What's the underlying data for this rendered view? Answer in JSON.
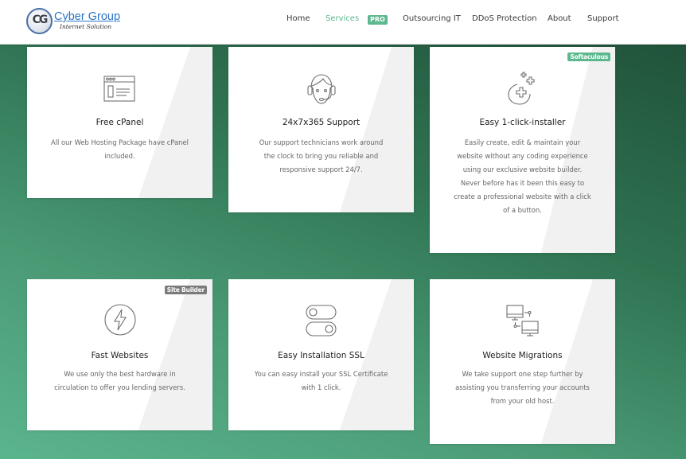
{
  "header": {
    "logo": {
      "mark": "CG",
      "title": "Cyber Group",
      "subtitle": "Internet Solution"
    },
    "nav": [
      {
        "label": "Home",
        "active": false
      },
      {
        "label": "Services",
        "active": true
      },
      {
        "label": "Outsourcing IT",
        "active": false
      },
      {
        "label": "DDoS Protection",
        "active": false
      },
      {
        "label": "About",
        "active": false
      },
      {
        "label": "Support",
        "active": false
      }
    ],
    "nav_badge": "PRO"
  },
  "colors": {
    "accent": "#5cb88f",
    "badge_gray": "#7b7b7b",
    "bg_dark": "#1e4d36",
    "bg_light": "#5bb58d"
  },
  "features": [
    {
      "icon": "browser-window-icon",
      "title": "Free cPanel",
      "lines": [
        "All our Web Hosting Package have cPanel",
        "included."
      ]
    },
    {
      "icon": "support-agent-icon",
      "title": "24x7x365 Support",
      "lines": [
        "Our support technicians work around",
        "the clock to bring you reliable and",
        "responsive support 24/7."
      ]
    },
    {
      "icon": "magic-installer-icon",
      "title": "Easy 1-click-installer",
      "badge": "Softaculous",
      "lines": [
        "Easily create, edit & maintain your",
        "website without any coding experience",
        "using our exclusive website builder.",
        "Never before has it been this easy to",
        "create a professional website with a click",
        "of a button."
      ]
    },
    {
      "icon": "lightning-icon",
      "title": "Fast Websites",
      "badge": "Site Builder",
      "lines": [
        "We use only the best hardware in",
        "circulation to offer you lending servers."
      ]
    },
    {
      "icon": "toggle-switch-icon",
      "title": "Easy Installation SSL",
      "lines": [
        "You can easy install your SSL Certificate",
        "with 1 click."
      ]
    },
    {
      "icon": "migration-monitors-icon",
      "title": "Website Migrations",
      "lines": [
        "We take support one step further by",
        "assisting you transferring your accounts",
        "from your old host."
      ]
    }
  ]
}
